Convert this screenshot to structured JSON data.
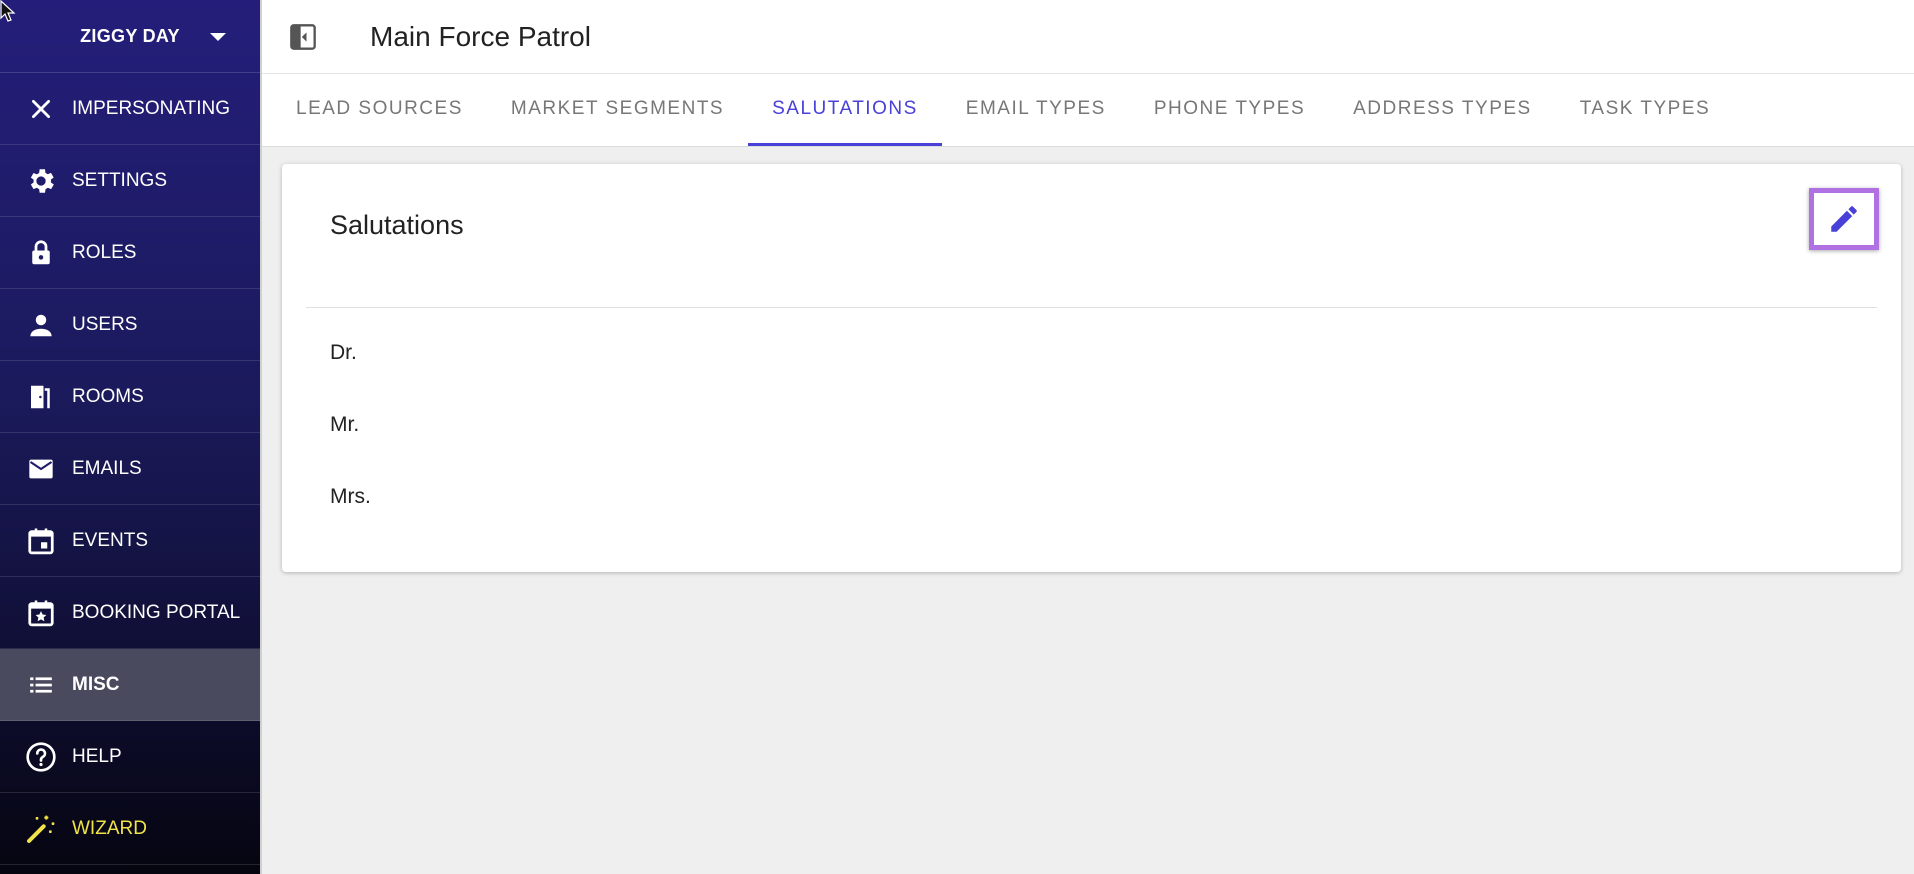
{
  "sidebar": {
    "user_name": "ZIGGY DAY",
    "items": [
      {
        "label": "IMPERSONATING",
        "icon": "close-icon"
      },
      {
        "label": "SETTINGS",
        "icon": "gear-icon"
      },
      {
        "label": "ROLES",
        "icon": "lock-icon"
      },
      {
        "label": "USERS",
        "icon": "person-icon"
      },
      {
        "label": "ROOMS",
        "icon": "door-icon"
      },
      {
        "label": "EMAILS",
        "icon": "mail-icon"
      },
      {
        "label": "EVENTS",
        "icon": "calendar-icon"
      },
      {
        "label": "BOOKING PORTAL",
        "icon": "calendar-star-icon"
      },
      {
        "label": "MISC",
        "icon": "list-icon",
        "active": true
      },
      {
        "label": "HELP",
        "icon": "help-icon"
      },
      {
        "label": "WIZARD",
        "icon": "magic-wand-icon"
      }
    ]
  },
  "header": {
    "title": "Main Force Patrol"
  },
  "tabs": [
    {
      "label": "LEAD SOURCES"
    },
    {
      "label": "MARKET SEGMENTS"
    },
    {
      "label": "SALUTATIONS",
      "active": true
    },
    {
      "label": "EMAIL TYPES"
    },
    {
      "label": "PHONE TYPES"
    },
    {
      "label": "ADDRESS TYPES"
    },
    {
      "label": "TASK TYPES"
    }
  ],
  "card": {
    "title": "Salutations",
    "items": [
      "Dr.",
      "Mr.",
      "Mrs."
    ]
  },
  "colors": {
    "accent": "#4840d8",
    "edit_highlight": "#b071e3",
    "wizard": "#f1e34a"
  }
}
